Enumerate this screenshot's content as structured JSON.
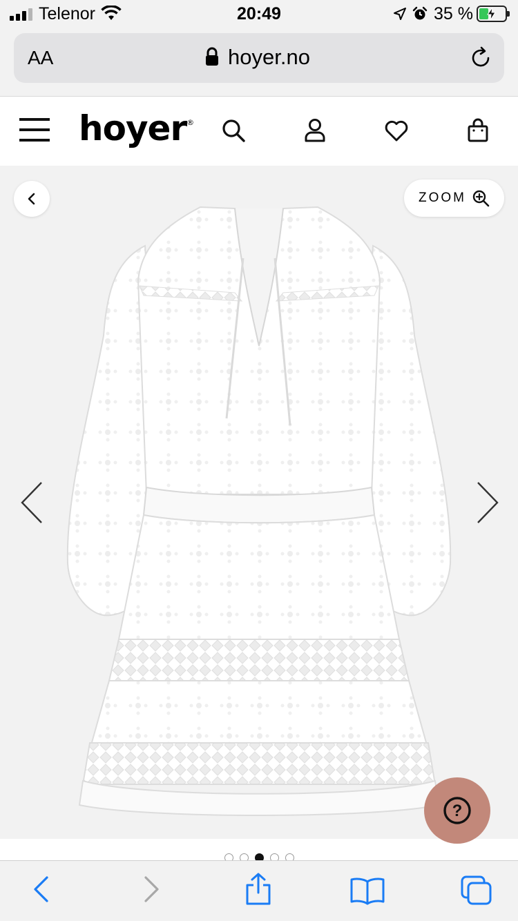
{
  "status_bar": {
    "carrier": "Telenor",
    "time": "20:49",
    "battery_percent": "35 %",
    "battery_level": 0.35,
    "battery_charging": true,
    "icons": [
      "signal-icon",
      "wifi-icon",
      "location-icon",
      "alarm-icon",
      "battery-icon"
    ]
  },
  "browser": {
    "text_size_label": "AA",
    "url": "hoyer.no",
    "icons": [
      "lock-icon",
      "reload-icon"
    ]
  },
  "site_header": {
    "logo_text": "hoyer",
    "logo_mark": "®",
    "icons": [
      "menu-icon",
      "search-icon",
      "account-icon",
      "heart-icon",
      "bag-icon"
    ]
  },
  "gallery": {
    "zoom_label": "ZOOM",
    "image_count": 5,
    "active_index": 3,
    "icons": [
      "back-chevron-icon",
      "zoom-in-icon",
      "previous-arrow-icon",
      "next-arrow-icon",
      "help-icon"
    ]
  },
  "help_button": {
    "label": "?"
  },
  "colors": {
    "help_button": "#c2887a",
    "ios_blue": "#1a7cf5",
    "battery_green": "#35c759"
  },
  "toolbar": {
    "icons": [
      "back-icon",
      "forward-icon",
      "share-icon",
      "bookmarks-icon",
      "tabs-icon"
    ]
  }
}
